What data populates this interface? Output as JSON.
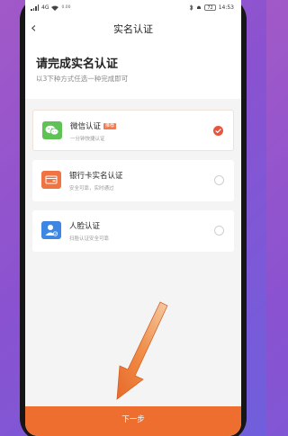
{
  "statusbar": {
    "left_text": "4G",
    "small_text": "0.00",
    "battery": "72",
    "time": "14:53"
  },
  "navbar": {
    "back_icon": "chevron-left-icon",
    "title": "实名认证"
  },
  "header": {
    "headline": "请完成实名认证",
    "subline": "以3下种方式任选一种完成即可"
  },
  "methods": [
    {
      "title": "微信认证",
      "badge": "推荐",
      "subtitle": "一分钟快捷认证",
      "icon": "wechat-icon",
      "color": "#5ec255",
      "selected": true
    },
    {
      "title": "银行卡实名认证",
      "subtitle": "安全可靠，实时通过",
      "icon": "bank-card-icon",
      "color": "#f07342",
      "selected": false
    },
    {
      "title": "人脸认证",
      "subtitle": "扫脸认证安全可靠",
      "icon": "face-user-icon",
      "color": "#3d86e1",
      "selected": false
    }
  ],
  "footer": {
    "next_label": "下一步"
  },
  "colors": {
    "accent": "#ee6e2f",
    "checked": "#e8553e"
  }
}
